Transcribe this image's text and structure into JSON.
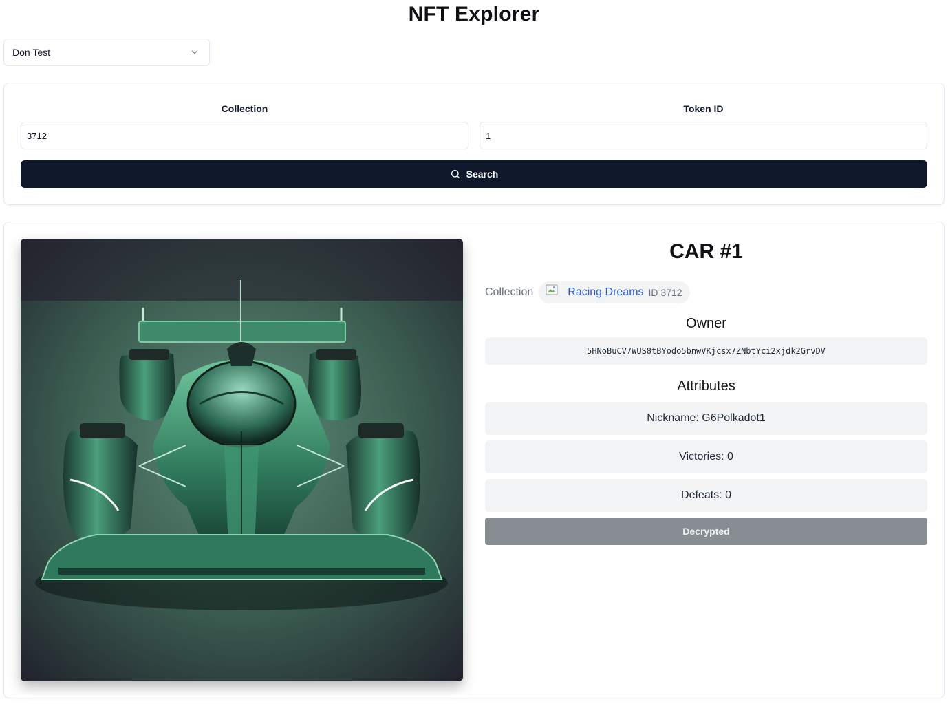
{
  "header": {
    "title": "NFT Explorer"
  },
  "account_select": {
    "value": "Don Test"
  },
  "search_form": {
    "collection_label": "Collection",
    "collection_value": "3712",
    "token_label": "Token ID",
    "token_value": "1",
    "search_label": "Search"
  },
  "nft": {
    "title": "CAR #1",
    "collection_label": "Collection",
    "collection_name": "Racing Dreams",
    "collection_id": "ID 3712",
    "owner_title": "Owner",
    "owner_address": "5HNoBuCV7WUS8tBYodo5bnwVKjcsx7ZNbtYci2xjdk2GrvDV",
    "attributes_title": "Attributes",
    "attributes": [
      "Nickname: G6Polkadot1",
      "Victories: 0",
      "Defeats: 0"
    ],
    "decrypt_label": "Decrypted"
  },
  "icons": {
    "select_chevron": "chevron-down-icon",
    "search": "search-icon",
    "collection_image": "broken-image-icon"
  },
  "colors": {
    "primary_button": "#0f172a",
    "disabled_button": "#888d94",
    "link": "#2d5bd0",
    "chip_background": "#f1f3f5"
  }
}
